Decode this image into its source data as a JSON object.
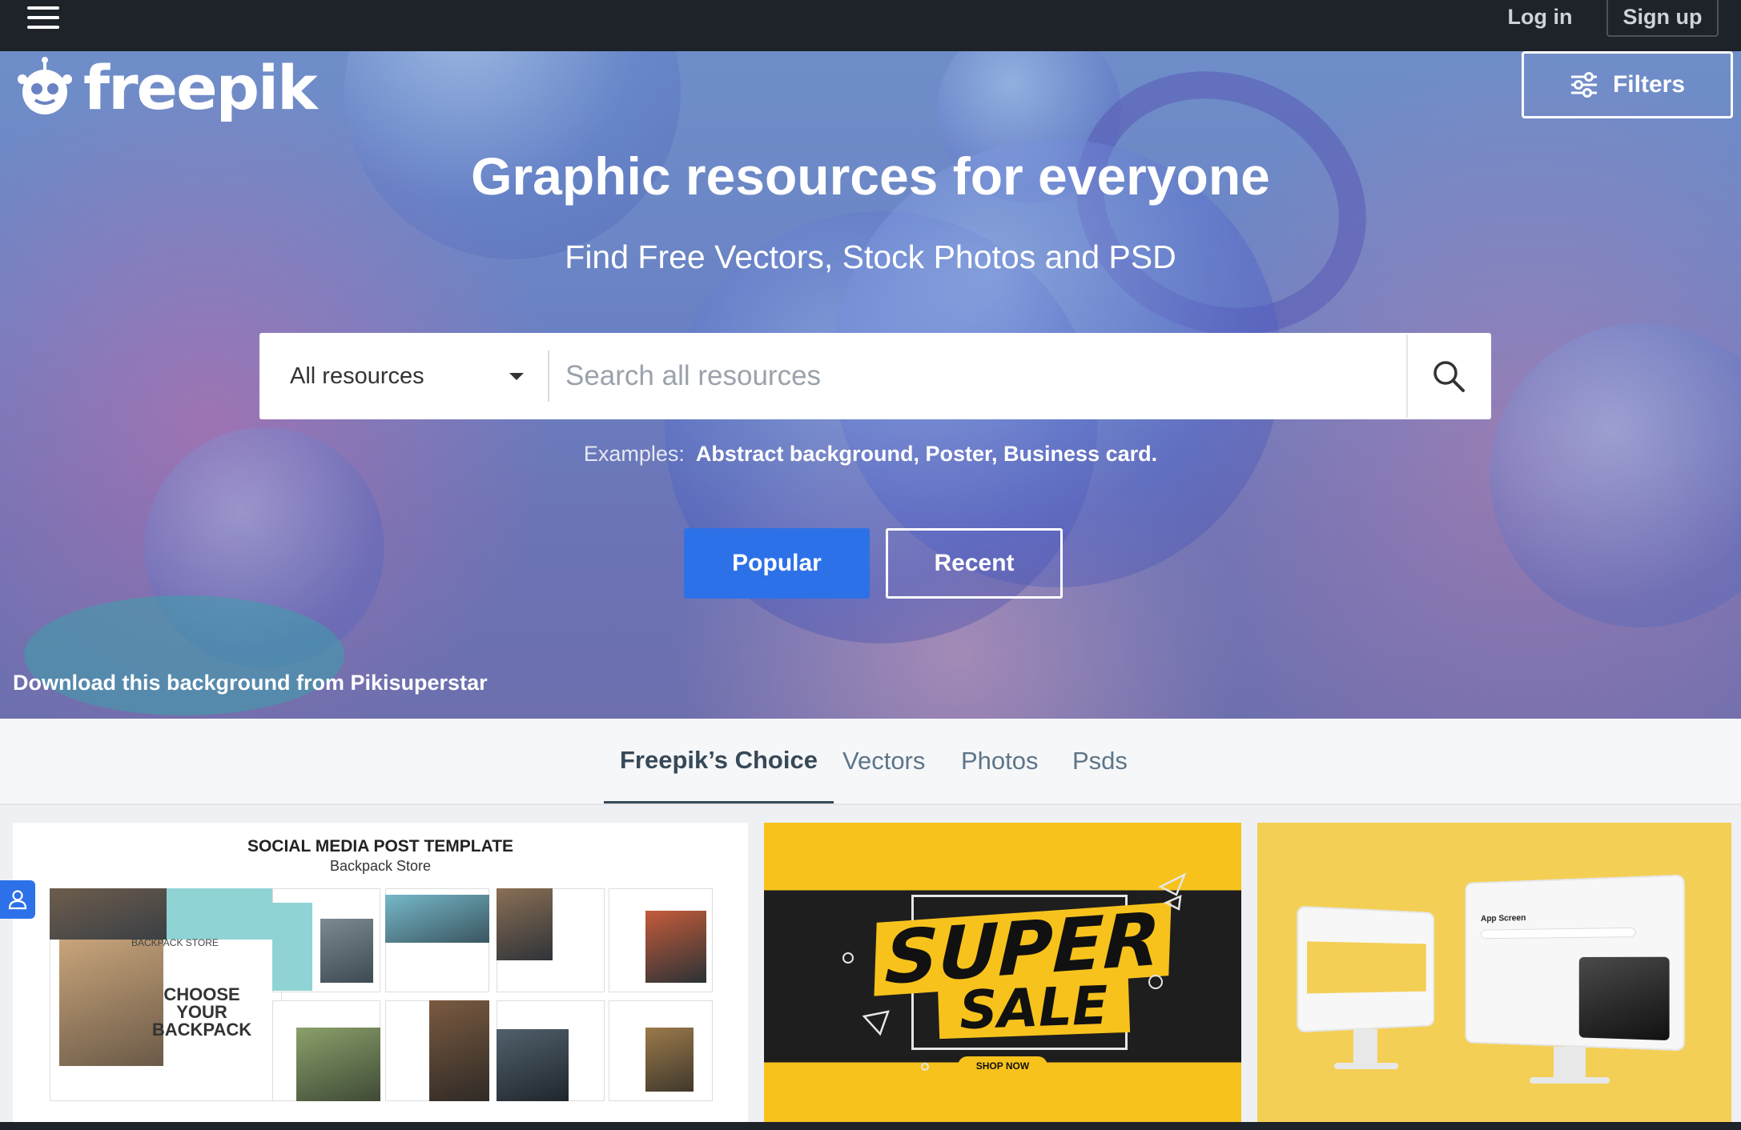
{
  "header": {
    "login_label": "Log in",
    "signup_label": "Sign up",
    "background_color": "#1e2329"
  },
  "hero": {
    "logo_text": "freepik",
    "filters_label": "Filters",
    "title": "Graphic resources for everyone",
    "subtitle": "Find Free Vectors, Stock Photos and PSD",
    "search": {
      "resource_select": "All resources",
      "placeholder": "Search all resources"
    },
    "examples_label": "Examples:",
    "examples": [
      "Abstract background",
      "Poster",
      "Business card"
    ],
    "popular_label": "Popular",
    "recent_label": "Recent",
    "background_credit": "Download this background from Pikisuperstar",
    "accent_color": "#2d71e8"
  },
  "tabs": [
    {
      "label": "Freepik’s Choice",
      "active": true
    },
    {
      "label": "Vectors",
      "active": false
    },
    {
      "label": "Photos",
      "active": false
    },
    {
      "label": "Psds",
      "active": false
    }
  ],
  "cards": {
    "card1": {
      "title": "SOCIAL MEDIA POST TEMPLATE",
      "subtitle": "Backpack Store",
      "store_name": "BACKPACK STORE",
      "headline": "CHOOSE YOUR BACKPACK"
    },
    "card2": {
      "line1": "SUPER",
      "line2": "SALE",
      "cta": "SHOP NOW"
    },
    "card3": {
      "screen_label": "App Screen"
    }
  }
}
